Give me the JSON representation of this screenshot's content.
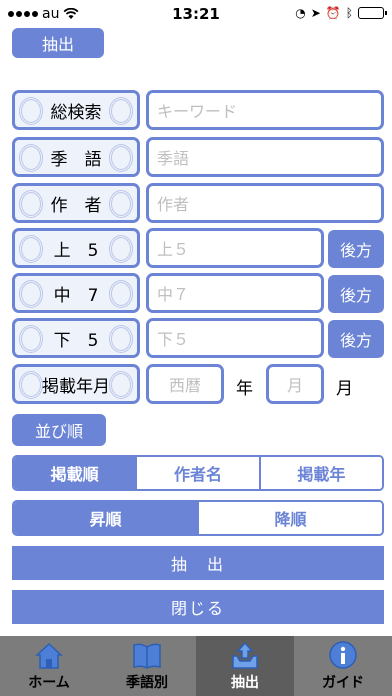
{
  "status": {
    "carrier": "au",
    "time": "13:21"
  },
  "top_extract_label": "抽出",
  "labels": {
    "keyword": "総検索",
    "season": "季　語",
    "author": "作　者",
    "upper5": "上　5",
    "middle7": "中　7",
    "lower5": "下　5",
    "published": "掲載年月"
  },
  "placeholders": {
    "keyword": "キーワード",
    "season": "季語",
    "author": "作者",
    "upper5": "上５",
    "middle7": "中７",
    "lower5": "下５",
    "year": "西暦",
    "month": "月"
  },
  "backward_label": "後方",
  "year_unit": "年",
  "month_unit": "月",
  "sort_label": "並び順",
  "sort_keys": [
    "掲載順",
    "作者名",
    "掲載年"
  ],
  "sort_order": [
    "昇順",
    "降順"
  ],
  "extract_button": "抽　出",
  "close_button": "閉じる",
  "tabs": [
    "ホーム",
    "季語別",
    "抽出",
    "ガイド"
  ],
  "colors": {
    "accent": "#6b84d6",
    "tabbar": "#7c7c7c"
  }
}
